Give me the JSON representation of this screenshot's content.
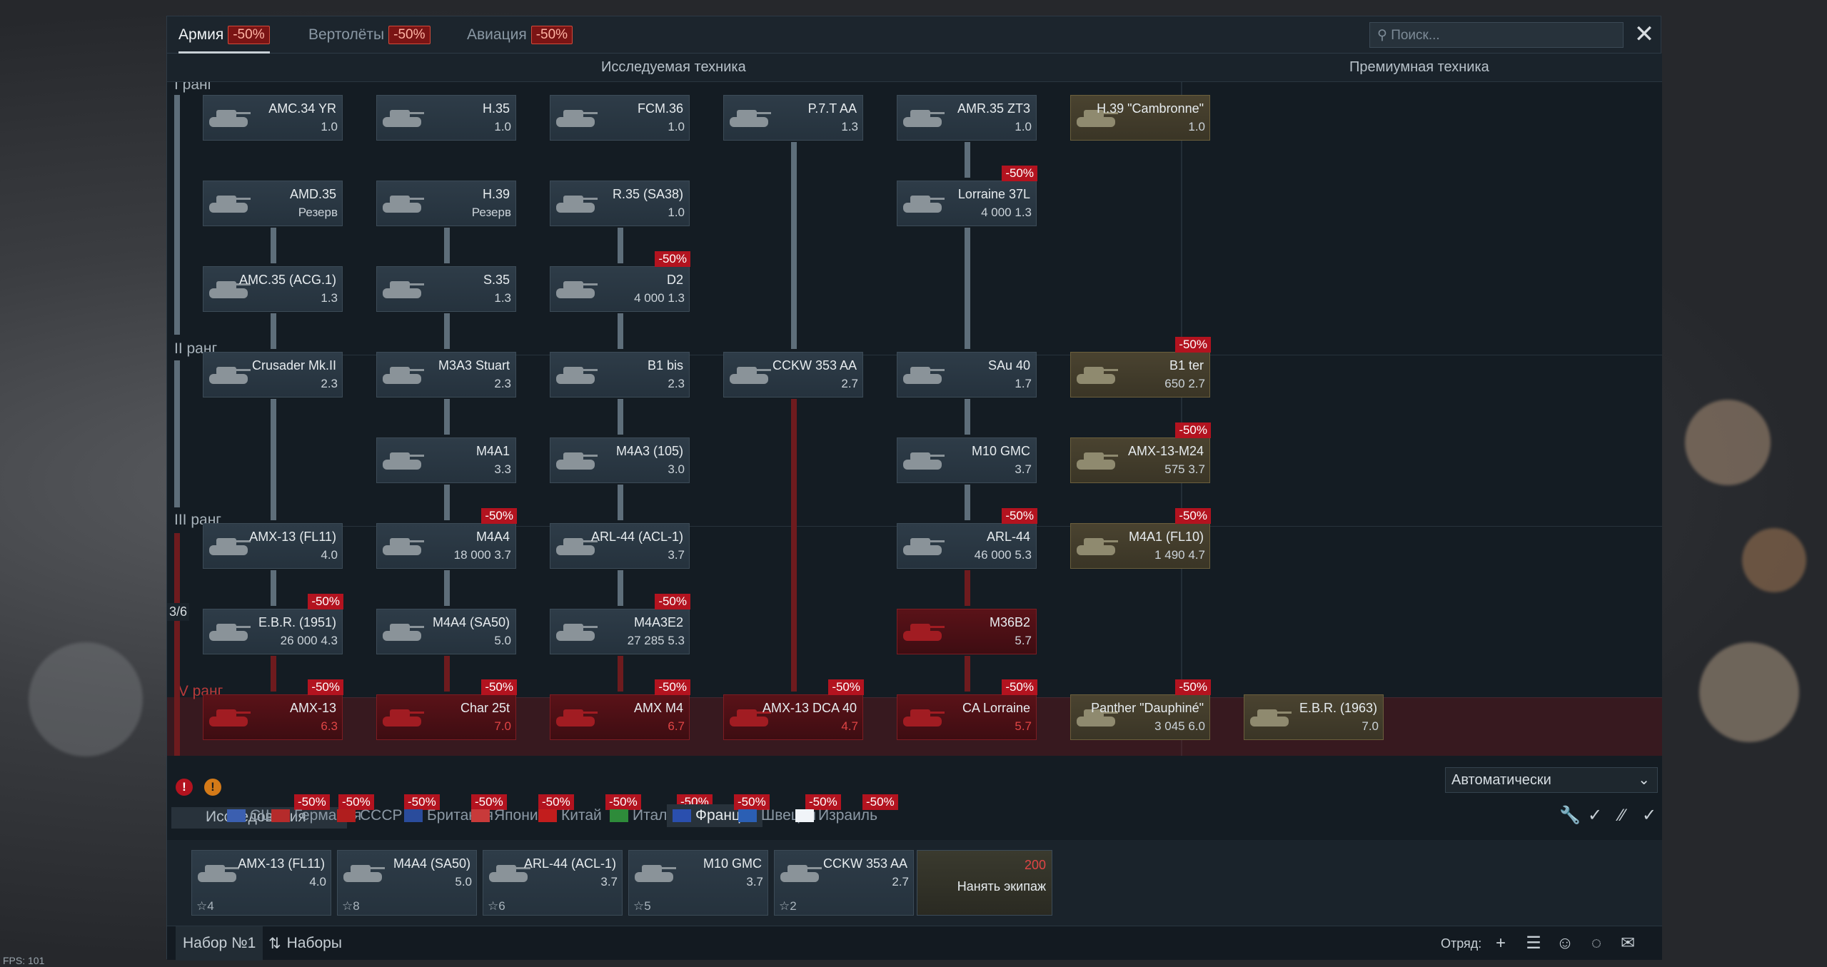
{
  "tabs": [
    {
      "label": "Армия",
      "sale": "-50%"
    },
    {
      "label": "Вертолёты",
      "sale": "-50%"
    },
    {
      "label": "Авиация",
      "sale": "-50%"
    }
  ],
  "search": {
    "placeholder": "Поиск..."
  },
  "headers": {
    "research": "Исследуемая техника",
    "premium": "Премиумная техника"
  },
  "ranks": [
    "I ранг",
    "II ранг",
    "III ранг",
    "IV ранг"
  ],
  "rank_progress": "3/6",
  "vehicles": [
    {
      "name": "AMC.34 YR",
      "br": "1.0"
    },
    {
      "name": "H.35",
      "br": "1.0"
    },
    {
      "name": "FCM.36",
      "br": "1.0"
    },
    {
      "name": "P.7.T AA",
      "br": "1.3"
    },
    {
      "name": "AMR.35 ZT3",
      "br": "1.0"
    },
    {
      "name": "H.39 \"Cambronne\"",
      "br": "1.0"
    },
    {
      "name": "AMD.35",
      "br": "Резерв"
    },
    {
      "name": "H.39",
      "br": "Резерв"
    },
    {
      "name": "R.35 (SA38)",
      "br": "1.0"
    },
    {
      "name": "Lorraine 37L",
      "br": "4 000  1.3",
      "sale": "-50%"
    },
    {
      "name": "AMC.35 (ACG.1)",
      "br": "1.3"
    },
    {
      "name": "S.35",
      "br": "1.3"
    },
    {
      "name": "D2",
      "br": "4 000  1.3",
      "sale": "-50%"
    },
    {
      "name": "Crusader Mk.II",
      "br": "2.3"
    },
    {
      "name": "M3A3 Stuart",
      "br": "2.3"
    },
    {
      "name": "B1 bis",
      "br": "2.3"
    },
    {
      "name": "CCKW 353 AA",
      "br": "2.7"
    },
    {
      "name": "SAu 40",
      "br": "1.7"
    },
    {
      "name": "B1 ter",
      "br": "650  2.7",
      "sale": "-50%"
    },
    {
      "name": "M4A1",
      "br": "3.3"
    },
    {
      "name": "M4A3 (105)",
      "br": "3.0"
    },
    {
      "name": "M10 GMC",
      "br": "3.7"
    },
    {
      "name": "AMX-13-M24",
      "br": "575  3.7",
      "sale": "-50%"
    },
    {
      "name": "AMX-13 (FL11)",
      "br": "4.0"
    },
    {
      "name": "M4A4",
      "br": "18 000  3.7",
      "sale": "-50%"
    },
    {
      "name": "ARL-44 (ACL-1)",
      "br": "3.7"
    },
    {
      "name": "ARL-44",
      "br": "46 000  5.3",
      "sale": "-50%"
    },
    {
      "name": "M4A1 (FL10)",
      "br": "1 490  4.7",
      "sale": "-50%"
    },
    {
      "name": "E.B.R. (1951)",
      "br": "26 000  4.3",
      "sale": "-50%"
    },
    {
      "name": "M4A4 (SA50)",
      "br": "5.0"
    },
    {
      "name": "M4A3E2",
      "br": "27 285  5.3",
      "sale": "-50%"
    },
    {
      "name": "M36B2",
      "br": "5.7"
    },
    {
      "name": "AMX-13",
      "br": "6.3",
      "sale": "-50%"
    },
    {
      "name": "Char 25t",
      "br": "7.0",
      "sale": "-50%"
    },
    {
      "name": "AMX M4",
      "br": "6.7",
      "sale": "-50%"
    },
    {
      "name": "AMX-13 DCA 40",
      "br": "4.7",
      "sale": "-50%"
    },
    {
      "name": "CA Lorraine",
      "br": "5.7",
      "sale": "-50%"
    },
    {
      "name": "Panther \"Dauphiné\"",
      "br": "3 045  6.0",
      "sale": "-50%"
    },
    {
      "name": "E.B.R. (1963)",
      "br": "7.0"
    }
  ],
  "research_label": "Исследования",
  "nations": [
    {
      "label": "США",
      "sale": "-50%"
    },
    {
      "label": "Германия",
      "sale": "-50%"
    },
    {
      "label": "СССР",
      "sale": "-50%"
    },
    {
      "label": "Британия",
      "sale": "-50%"
    },
    {
      "label": "Япония",
      "sale": "-50%"
    },
    {
      "label": "Китай",
      "sale": "-50%"
    },
    {
      "label": "Италия",
      "sale": "-50%"
    },
    {
      "label": "Франция",
      "sale": "-50%"
    },
    {
      "label": "Швеция",
      "sale": "-50%"
    },
    {
      "label": "Израиль",
      "sale": "-50%"
    }
  ],
  "auto_select": "Автоматически",
  "crew": [
    {
      "name": "AMX-13 (FL11)",
      "br": "4.0",
      "crew": "4"
    },
    {
      "name": "M4A4 (SA50)",
      "br": "5.0",
      "crew": "8"
    },
    {
      "name": "ARL-44 (ACL-1)",
      "br": "3.7",
      "crew": "6"
    },
    {
      "name": "M10 GMC",
      "br": "3.7",
      "crew": "5"
    },
    {
      "name": "CCKW 353 AA",
      "br": "2.7",
      "crew": "2"
    }
  ],
  "hire": {
    "cost": "200",
    "label": "Нанять экипаж"
  },
  "bottom": {
    "preset": "Набор №1",
    "presets": "Наборы",
    "squad": "Отряд:"
  },
  "fps": "FPS: 101",
  "colors": {
    "sale": "#b3131f",
    "premium": "#4a4330",
    "locked": "#5a1218",
    "accent": "#c8d0d6"
  }
}
